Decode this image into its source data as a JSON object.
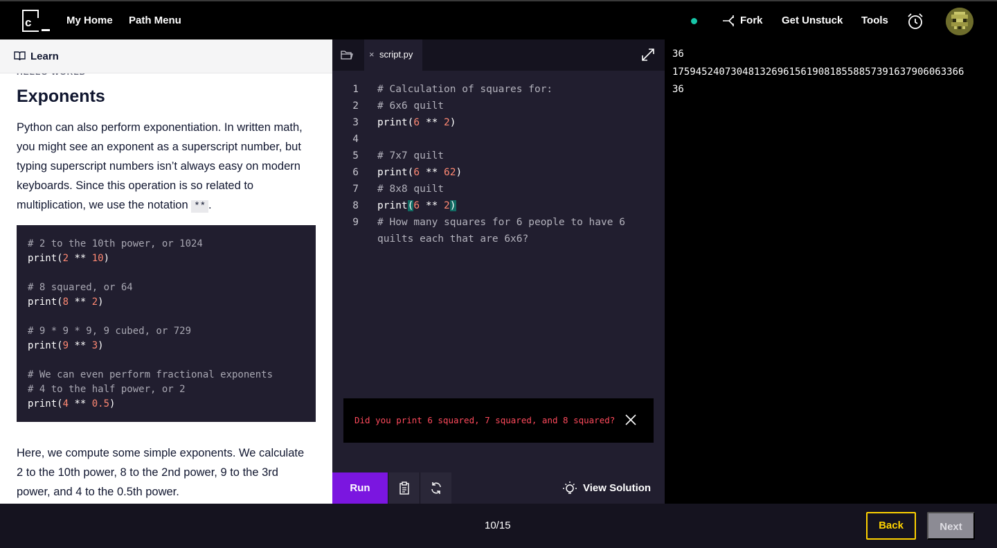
{
  "topnav": {
    "logo_letter": "c",
    "my_home": "My Home",
    "path_menu": "Path Menu",
    "fork": "Fork",
    "get_unstuck": "Get Unstuck",
    "tools": "Tools",
    "status_color": "#17c6a8",
    "icons": [
      "fork-icon",
      "alarm-clock-icon",
      "avatar"
    ]
  },
  "learn": {
    "header_label": "Learn",
    "section_label": "HELLO WORLD",
    "title": "Exponents",
    "para1_before": "Python can also perform exponentiation. In written math, you might see an exponent as a superscript number, but typing superscript numbers isn’t always easy on modern keyboards. Since this operation is so related to multiplication, we use the notation ",
    "para1_code": "**",
    "para1_after": ".",
    "code_sample": [
      {
        "c": "# 2 to the 10th power, or 1024"
      },
      {
        "p": "print(",
        "a": "2",
        "op": " ** ",
        "b": "10",
        "e": ")"
      },
      {
        "blank": ""
      },
      {
        "c": "# 8 squared, or 64"
      },
      {
        "p": "print(",
        "a": "8",
        "op": " ** ",
        "b": "2",
        "e": ")"
      },
      {
        "blank": ""
      },
      {
        "c": "# 9 * 9 * 9, 9 cubed, or 729"
      },
      {
        "p": "print(",
        "a": "9",
        "op": " ** ",
        "b": "3",
        "e": ")"
      },
      {
        "blank": ""
      },
      {
        "c": "# We can even perform fractional exponents"
      },
      {
        "c": "# 4 to the half power, or 2"
      },
      {
        "p": "print(",
        "a": "4",
        "op": " ** ",
        "b": "0.5",
        "e": ")"
      }
    ],
    "para2": "Here, we compute some simple exponents. We calculate 2 to the 10th power, 8 to the 2nd power, 9 to the 3rd power, and 4 to the 0.5th power."
  },
  "editor": {
    "file_tab": "script.py",
    "close_glyph": "×",
    "lines": [
      {
        "n": "1",
        "c": "# Calculation of squares for:"
      },
      {
        "n": "2",
        "c": "# 6x6 quilt"
      },
      {
        "n": "3",
        "p": "print(",
        "a": "6",
        "op": " ** ",
        "b": "2",
        "e": ")"
      },
      {
        "n": "4",
        "blank": ""
      },
      {
        "n": "5",
        "c": "# 7x7 quilt"
      },
      {
        "n": "6",
        "p": "print(",
        "a": "6",
        "op": " ** ",
        "b": "62",
        "e": ")"
      },
      {
        "n": "7",
        "c": "# 8x8 quilt"
      },
      {
        "n": "8",
        "p": "print",
        "lp": "(",
        "a": "6",
        "op": " ** ",
        "b": "2",
        "rp": ")"
      },
      {
        "n": "9",
        "c": "# How many squares for 6 people to have 6"
      },
      {
        "n": "",
        "c": "quilts each that are 6x6?"
      }
    ],
    "hint": "Did you print 6 squared, 7 squared, and 8 squared?"
  },
  "toolbar": {
    "run": "Run",
    "view_solution": "View Solution"
  },
  "output": {
    "lines": [
      "36",
      "17594524073048132696156190818558857391637906063366",
      "36"
    ]
  },
  "footer": {
    "progress": "10/15",
    "back": "Back",
    "next": "Next"
  },
  "colors": {
    "accent_run": "#7b16e0",
    "back_yellow": "#ffd300",
    "hint_red": "#ff4a5c",
    "number_orange": "#ff8973"
  }
}
